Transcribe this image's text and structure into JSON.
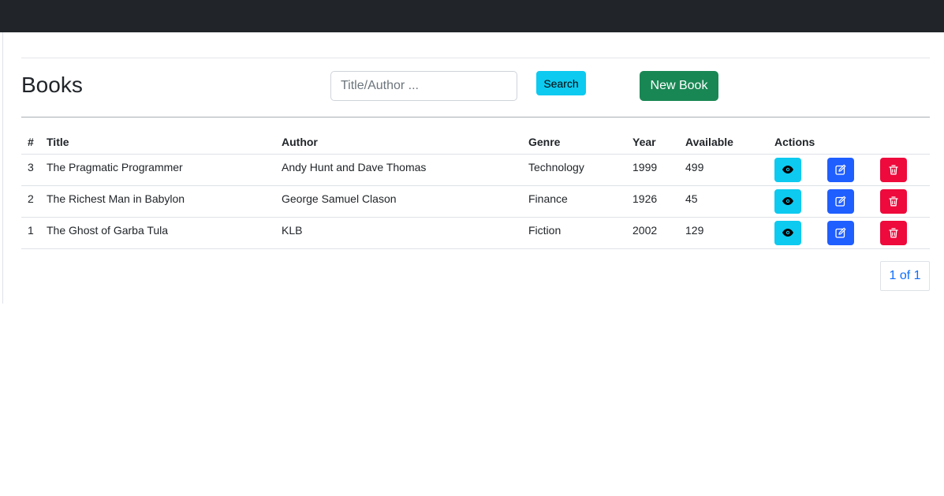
{
  "page": {
    "title": "Books"
  },
  "search": {
    "placeholder": "Title/Author ...",
    "value": "",
    "button_label": "Search"
  },
  "new_book": {
    "label": "New Book"
  },
  "table": {
    "headers": [
      "#",
      "Title",
      "Author",
      "Genre",
      "Year",
      "Available",
      "Actions"
    ],
    "rows": [
      {
        "id": "3",
        "title": "The Pragmatic Programmer",
        "author": "Andy Hunt and Dave Thomas",
        "genre": "Technology",
        "year": "1999",
        "available": "499"
      },
      {
        "id": "2",
        "title": "The Richest Man in Babylon",
        "author": "George Samuel Clason",
        "genre": "Finance",
        "year": "1926",
        "available": "45"
      },
      {
        "id": "1",
        "title": "The Ghost of Garba Tula",
        "author": "KLB",
        "genre": "Fiction",
        "year": "2002",
        "available": "129"
      }
    ],
    "actions": {
      "view_icon": "eye-icon",
      "edit_icon": "edit-icon",
      "delete_icon": "trash-icon"
    }
  },
  "pagination": {
    "label": "1 of 1"
  },
  "colors": {
    "navbar": "#212529",
    "search_button": "#0dcaf0",
    "new_button": "#198754",
    "view_button": "#0dcaf0",
    "edit_button": "#1f5eff",
    "delete_button": "#ee0a3c",
    "link": "#0d6efd"
  }
}
